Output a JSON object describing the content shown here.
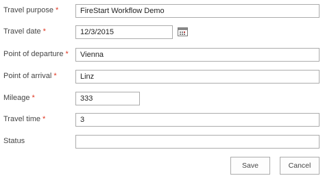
{
  "form": {
    "travel_purpose": {
      "label": "Travel purpose",
      "required": "*",
      "value": "FireStart Workflow Demo"
    },
    "travel_date": {
      "label": "Travel date",
      "required": "*",
      "value": "12/3/2015",
      "icon": "calendar-icon"
    },
    "point_of_departure": {
      "label": "Point of departure",
      "required": "*",
      "value": "Vienna"
    },
    "point_of_arrival": {
      "label": "Point of arrival",
      "required": "*",
      "value": "Linz"
    },
    "mileage": {
      "label": "Mileage",
      "required": "*",
      "value": "333"
    },
    "travel_time": {
      "label": "Travel time",
      "required": "*",
      "value": "3"
    },
    "status": {
      "label": "Status",
      "value": ""
    }
  },
  "actions": {
    "save_label": "Save",
    "cancel_label": "Cancel"
  },
  "colors": {
    "required_marker": "#e0341f",
    "border": "#ababab"
  }
}
